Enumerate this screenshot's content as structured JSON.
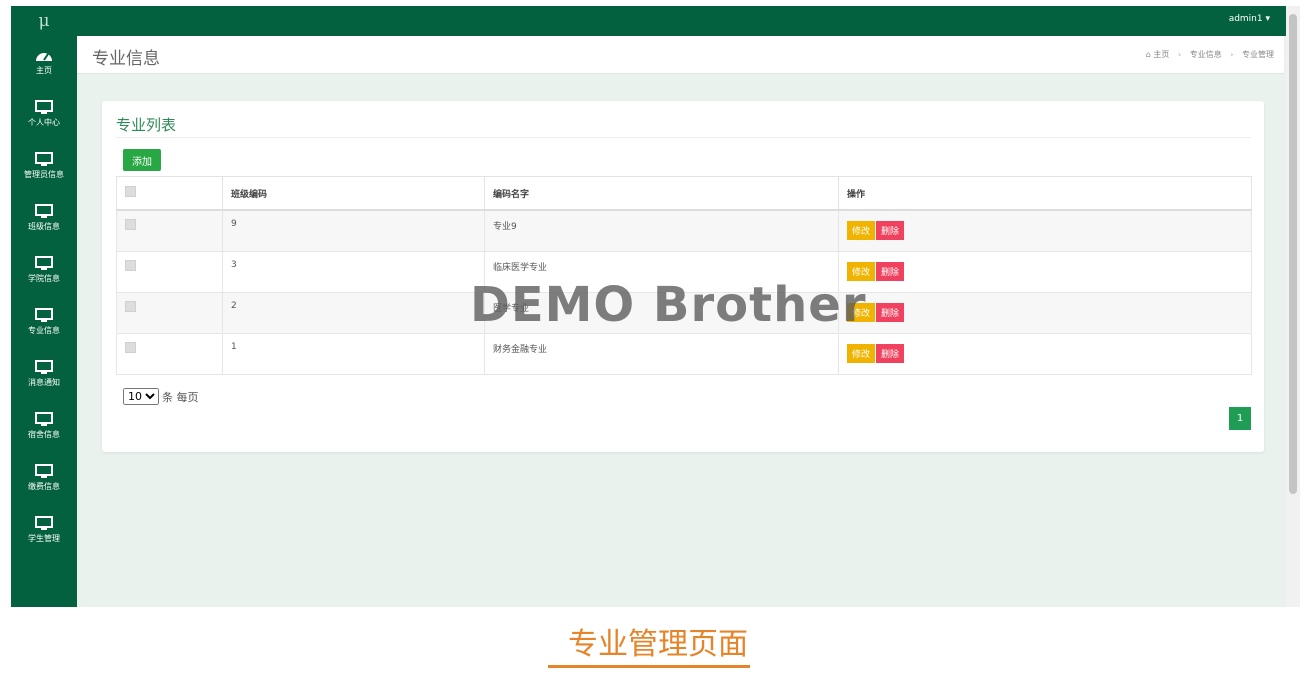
{
  "app": {
    "logo": "μ",
    "user": "admin1 ▾"
  },
  "sidebar": {
    "items": [
      {
        "label": "主页",
        "icon": "dashboard-icon"
      },
      {
        "label": "个人中心",
        "icon": "monitor-icon"
      },
      {
        "label": "管理员信息",
        "icon": "monitor-icon"
      },
      {
        "label": "班级信息",
        "icon": "monitor-icon"
      },
      {
        "label": "学院信息",
        "icon": "monitor-icon"
      },
      {
        "label": "专业信息",
        "icon": "monitor-icon"
      },
      {
        "label": "消息通知",
        "icon": "monitor-icon"
      },
      {
        "label": "宿舍信息",
        "icon": "monitor-icon"
      },
      {
        "label": "缴费信息",
        "icon": "monitor-icon"
      },
      {
        "label": "学生管理",
        "icon": "monitor-icon"
      }
    ]
  },
  "header": {
    "title": "专业信息",
    "breadcrumb": [
      "主页",
      "专业信息",
      "专业管理"
    ]
  },
  "card": {
    "title": "专业列表",
    "add_label": "添加",
    "columns": [
      "",
      "班级编码",
      "编码名字",
      "操作"
    ],
    "rows": [
      {
        "code": "9",
        "name": "专业9"
      },
      {
        "code": "3",
        "name": "临床医学专业"
      },
      {
        "code": "2",
        "name": "医学专业"
      },
      {
        "code": "1",
        "name": "财务金融专业"
      }
    ],
    "edit_label": "修改",
    "delete_label": "删除",
    "page_size": "10",
    "page_size_suffix": "条 每页",
    "current_page": "1"
  },
  "watermark": "DEMO Brother",
  "caption": "专业管理页面",
  "colors": {
    "primary": "#03613f",
    "accent": "#28a745",
    "edit": "#f0b400",
    "delete": "#f0425e",
    "caption": "#e6842a"
  }
}
